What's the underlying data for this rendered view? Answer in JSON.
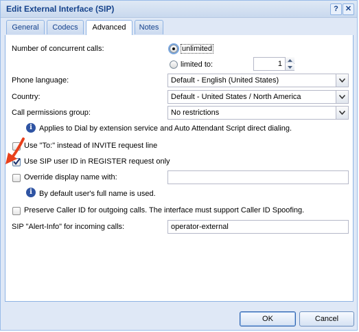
{
  "window": {
    "title": "Edit External Interface (SIP)",
    "help_label": "?",
    "close_label": "✕"
  },
  "tabs": [
    {
      "label": "General"
    },
    {
      "label": "Codecs"
    },
    {
      "label": "Advanced"
    },
    {
      "label": "Notes"
    }
  ],
  "active_tab": "Advanced",
  "form": {
    "concurrent_calls": {
      "label": "Number of concurrent calls:",
      "unlimited_label": "unlimited",
      "limited_label": "limited to:",
      "limited_value": "1",
      "selected": "unlimited"
    },
    "phone_language": {
      "label": "Phone language:",
      "value": "Default - English (United States)"
    },
    "country": {
      "label": "Country:",
      "value": "Default - United States / North America"
    },
    "call_permissions": {
      "label": "Call permissions group:",
      "value": "No restrictions"
    },
    "call_permissions_info": "Applies to Dial by extension service and Auto Attendant Script direct dialing.",
    "use_to_header": {
      "label": "Use \"To:\" instead of INVITE request line",
      "checked": false
    },
    "use_sip_user_id": {
      "label": "Use SIP user ID in REGISTER request only",
      "checked": true
    },
    "override_display_name": {
      "label": "Override display name with:",
      "value": "",
      "checked": false
    },
    "override_display_info": "By default user's full name is used.",
    "preserve_caller_id": {
      "label": "Preserve Caller ID for outgoing calls. The interface must support Caller ID Spoofing.",
      "checked": false
    },
    "alert_info": {
      "label": "SIP \"Alert-Info\" for incoming calls:",
      "value": "operator-external"
    }
  },
  "buttons": {
    "ok": "OK",
    "cancel": "Cancel"
  },
  "colors": {
    "title_text": "#15428b",
    "accent": "#2f54a3",
    "annotation_arrow": "#e8401c"
  }
}
